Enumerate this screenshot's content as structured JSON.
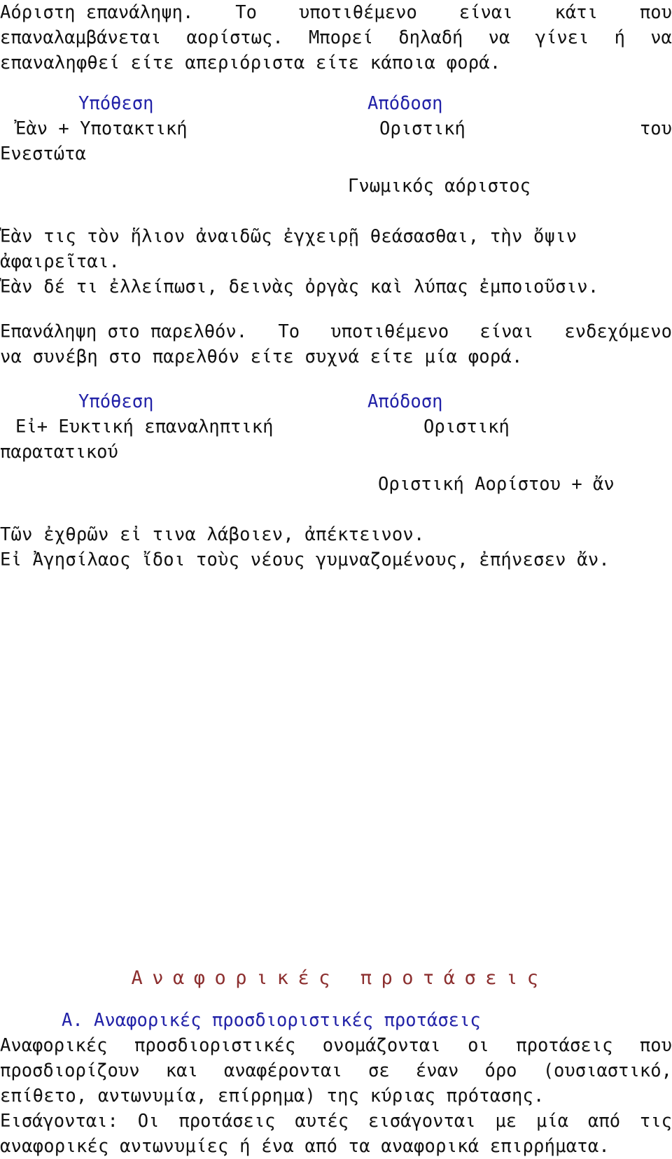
{
  "document": {
    "language": "el",
    "colors": {
      "red": "#b33a3a",
      "blue": "#2222a8",
      "maroon": "#8c2f2f",
      "body": "#111111",
      "background": "#ffffff"
    }
  },
  "section_indefinite_repetition": {
    "label": "Αόριστη επανάληψη.",
    "description_part1": " Το υποτιθέμενο είναι κάτι που",
    "description_line2": "επαναλαμβάνεται αορίστως. Μπορεί δηλαδή να γίνει ή να",
    "description_line3": "επαναληφθεί είτε απεριόριστα είτε κάποια φορά.",
    "table": {
      "header_left": "Υπόθεση",
      "header_right": "Απόδοση",
      "left_line1": "Ἐὰν + Υποτακτική",
      "left_line2": "Ενεστώτα",
      "right_line1": "Οριστική",
      "right_trailing": "του",
      "right_line2": "Γνωμικός αόριστος"
    },
    "examples": [
      "Ἐὰν τις τὸν ἥλιον ἀναιδῶς ἐγχειρῇ θεάσασθαι, τὴν ὄψιν",
      "ἀφαιρεῖται.",
      "Ἐὰν δέ τι ἐλλείπωσι, δεινὰς ὀργὰς καὶ λύπας ἐμποιοῦσιν."
    ]
  },
  "section_past_repetition": {
    "label": "Επανάληψη στο παρελθόν.",
    "description_part1": " Το υποτιθέμενο είναι ενδεχόμενο",
    "description_line2": "να συνέβη στο παρελθόν είτε συχνά είτε μία φορά.",
    "table": {
      "header_left": "Υπόθεση",
      "header_right": "Απόδοση",
      "left_line1": "Εἰ+ Ευκτική επαναληπτική",
      "left_line2": "παρατατικού",
      "right_line1": "Οριστική",
      "right_line2": "Οριστική Αορίστου + ἄν"
    },
    "examples": [
      "Τῶν ἐχθρῶν εἰ τινα λάβοιεν, ἀπέκτεινον.",
      "Εἰ Ἀγησίλαος ἴδοι τοὺς νέους γυμναζομένους, ἐπήνεσεν ἄν."
    ]
  },
  "section_relative_clauses": {
    "title": "Αναφορικές προτάσεις",
    "subsection_title": "Α. Αναφορικές προσδιοριστικές προτάσεις",
    "body_line1": "Αναφορικές προσδιοριστικές ονομάζονται οι προτάσεις που",
    "body_line2": "προσδιορίζουν και αναφέρονται σε έναν όρο (ουσιαστικό,",
    "body_line3": "επίθετο, αντωνυμία, επίρρημα) της κύριας πρότασης.",
    "intro_label": "Εισάγονται:",
    "intro_rest": " Οι προτάσεις αυτές εισάγονται με μία από τις",
    "intro_line2": "αναφορικές αντωνυμίες ή ένα από τα αναφορικά επιρρήματα."
  }
}
